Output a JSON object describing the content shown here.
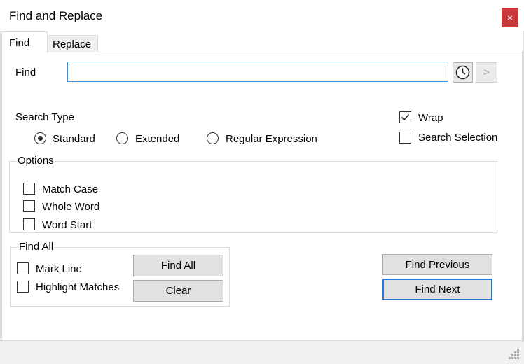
{
  "window": {
    "title": "Find and Replace",
    "close_glyph": "×"
  },
  "tabs": [
    {
      "label": "Find",
      "selected": true
    },
    {
      "label": "Replace",
      "selected": false
    }
  ],
  "find": {
    "label": "Find",
    "value": "",
    "history_icon": "clock-icon",
    "next_arrow": ">"
  },
  "search_type": {
    "label": "Search Type",
    "options": [
      {
        "label": "Standard",
        "checked": true
      },
      {
        "label": "Extended",
        "checked": false
      },
      {
        "label": "Regular Expression",
        "checked": false
      }
    ]
  },
  "wrap": {
    "label": "Wrap",
    "checked": true
  },
  "search_selection": {
    "label": "Search Selection",
    "checked": false
  },
  "options": {
    "label": "Options",
    "items": [
      {
        "label": "Match Case",
        "checked": false
      },
      {
        "label": "Whole Word",
        "checked": false
      },
      {
        "label": "Word Start",
        "checked": false
      }
    ]
  },
  "find_all": {
    "label": "Find All",
    "mark_line": {
      "label": "Mark Line",
      "checked": false
    },
    "highlight_matches": {
      "label": "Highlight Matches",
      "checked": false
    },
    "find_all_button": "Find All",
    "clear_button": "Clear"
  },
  "actions": {
    "find_previous": "Find Previous",
    "find_next": "Find Next"
  },
  "colors": {
    "close_button": "#c8373a",
    "focus_border": "#3b8ed6",
    "default_button_border": "#2b79d0"
  }
}
